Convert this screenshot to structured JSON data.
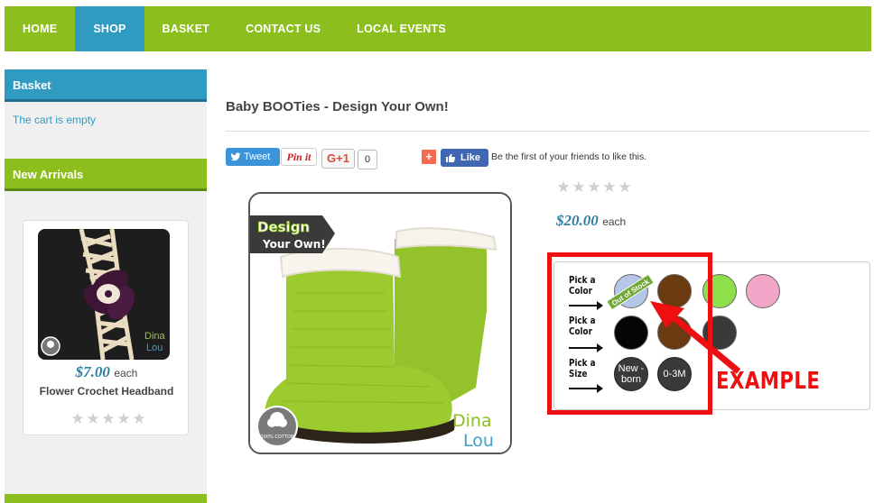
{
  "nav": {
    "items": [
      {
        "label": "HOME",
        "active": false
      },
      {
        "label": "SHOP",
        "active": true
      },
      {
        "label": "BASKET",
        "active": false
      },
      {
        "label": "CONTACT US",
        "active": false
      },
      {
        "label": "LOCAL EVENTS",
        "active": false
      }
    ]
  },
  "sidebar": {
    "basket": {
      "title": "Basket",
      "empty_text": "The cart is empty"
    },
    "new_arrivals": {
      "title": "New Arrivals",
      "item": {
        "price": "$7.00",
        "each": "each",
        "name": "Flower Crochet Headband",
        "brand_line1": "Dina",
        "brand_line2": "Lou",
        "rating": 0
      }
    }
  },
  "product": {
    "title": "Baby BOOTies - Design Your Own!",
    "price": "$20.00",
    "each": "each",
    "rating": 0,
    "image": {
      "banner_line1": "Design",
      "banner_line2": "Your Own!",
      "brand_line1": "Dina",
      "brand_line2": "Lou",
      "cotton_badge": "100% COTTON"
    }
  },
  "share": {
    "tweet": "Tweet",
    "pinit": "Pin it",
    "gplus": "G+1",
    "gplus_count": "0",
    "plus": "+",
    "like": "Like",
    "like_text": "Be the first of your friends to like this."
  },
  "options": {
    "color1_label": "Pick a Color",
    "color2_label": "Pick a Color",
    "size_label": "Pick a Size",
    "out_of_stock": "Out of Stock",
    "sizes": [
      "New -born",
      "0-3M"
    ],
    "example": "EXAMPLE",
    "colors": {
      "light_blue": "#b6c6e8",
      "brown": "#6b3a10",
      "lime": "#8ee04a",
      "pink": "#f4a6c8",
      "black": "#050505",
      "charcoal": "#3a3a3a"
    }
  },
  "colors": {
    "nav_green": "#8cbe1e",
    "accent_blue": "#2f9bc1",
    "highlight_red": "#ee1010"
  }
}
